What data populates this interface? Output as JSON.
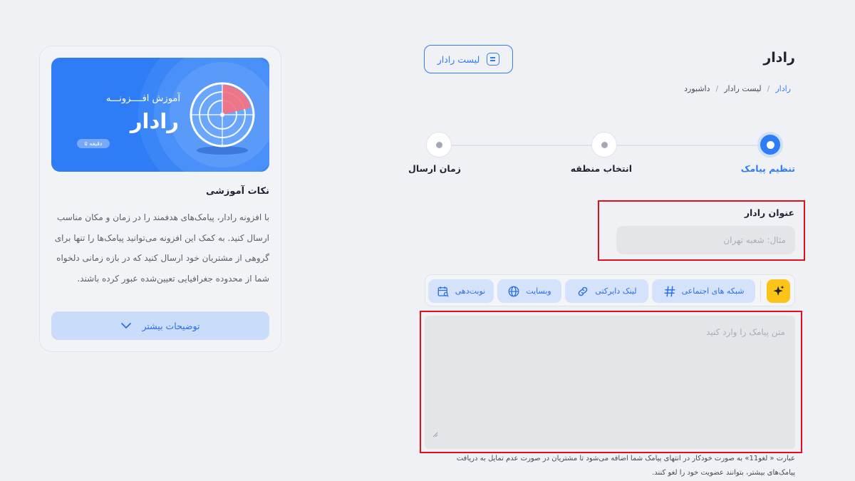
{
  "header": {
    "title": "رادار",
    "list_button_label": "لیست رادار",
    "breadcrumb": [
      "داشبورد",
      "لیست رادار",
      "رادار"
    ]
  },
  "stepper": {
    "steps": [
      {
        "label": "تنظیم پیامک",
        "active": true
      },
      {
        "label": "انتخاب منطقه",
        "active": false
      },
      {
        "label": "زمان ارسال",
        "active": false
      }
    ]
  },
  "form": {
    "title_label": "عنوان رادار",
    "title_placeholder": "مثال: شعبه تهران",
    "toolbar": {
      "ai_icon": "sparkle-icon",
      "chips": [
        {
          "label": "شبکه های اجتماعی",
          "icon": "hashtag-icon"
        },
        {
          "label": "لینک دایرکتی",
          "icon": "link-icon"
        },
        {
          "label": "وبسایت",
          "icon": "globe-icon"
        },
        {
          "label": "نوبت‌دهی",
          "icon": "calendar-search-icon"
        }
      ]
    },
    "message_placeholder": "متن پیامک را وارد کنید",
    "note": "عبارت « لغو11» به صورت خودکار در انتهای پیامک شما اضافه می‌شود تا مشتریان در صورت عدم تمایل به دریافت پیامک‌های بیشتر، بتوانند عضویت خود را لغو کنند."
  },
  "tips_card": {
    "banner_subtitle": "آموزش افــــزونـــه",
    "banner_title": "رادار",
    "banner_pill": "۵ دقیقه",
    "title": "نکات آموزشی",
    "text": "با افزونه رادار، پیامک‌های هدفمند را در زمان و مکان مناسب ارسال کنید. به کمک این افزونه می‌توانید پیامک‌ها را تنها برای گروهی از مشتریان خود ارسال کنید که در بازه زمانی دلخواه شما از محدوده جغرافیایی تعیین‌شده عبور کرده باشند.",
    "more_button": "توضیحات بیشتر"
  },
  "colors": {
    "accent": "#2e7cf6",
    "highlight_border": "#e0111b",
    "ai_button": "#fcc419",
    "page_bg": "#f0f1f4"
  }
}
